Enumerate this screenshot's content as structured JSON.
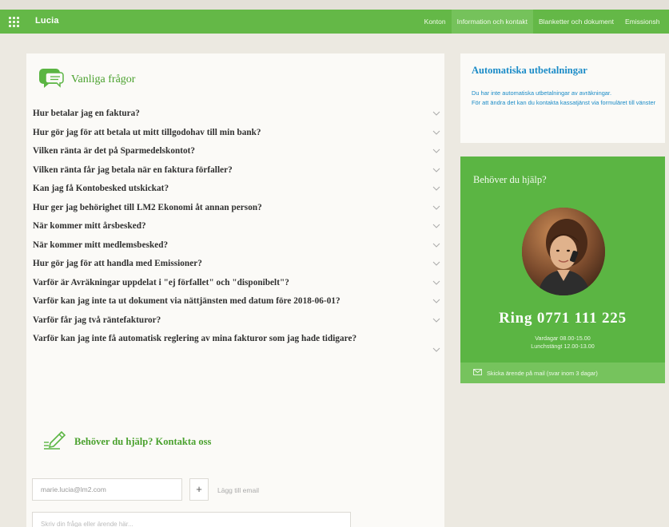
{
  "app": {
    "brand": "Lucia"
  },
  "nav": {
    "items": [
      {
        "label": "Konton",
        "active": false
      },
      {
        "label": "Information och kontakt",
        "active": true
      },
      {
        "label": "Blanketter och dokument",
        "active": false
      },
      {
        "label": "Emissionsh",
        "active": false
      }
    ]
  },
  "faq": {
    "title": "Vanliga frågor",
    "items": [
      "Hur betalar jag en faktura?",
      "Hur gör jag för att betala ut mitt tillgodohav till min bank?",
      "Vilken ränta är det på Sparmedelskontot?",
      "Vilken ränta får jag betala när en faktura förfaller?",
      "Kan jag få Kontobesked utskickat?",
      "Hur ger jag behörighet till LM2 Ekonomi åt annan person?",
      "När kommer mitt årsbesked?",
      "När kommer mitt medlemsbesked?",
      "Hur gör jag för att handla med Emissioner?",
      "Varför är Avräkningar uppdelat i \"ej förfallet\" och \"disponibelt\"?",
      "Varför kan jag inte ta ut dokument via nättjänsten med datum före 2018-06-01?",
      "Varför får jag två räntefakturor?",
      "Varför kan jag inte få automatisk reglering av mina fakturor som jag hade tidigare?"
    ]
  },
  "contact": {
    "title": "Behöver du hjälp? Kontakta oss",
    "email_value": "marie.lucia@lm2.com",
    "plus_label": "+",
    "add_email_label": "Lägg till email",
    "question_placeholder": "Skriv din fråga eller ärende här..."
  },
  "auto_payouts": {
    "title": "Automatiska utbetalningar",
    "text_line1": "Du har inte automatiska utbetalningar av avräkningar.",
    "text_line2": "För att ändra det kan du kontakta kassatjänst via formuläret till vänster"
  },
  "help": {
    "title": "Behöver du hjälp?",
    "phone": "Ring 0771 111 225",
    "hours_weekdays": "Vardagar 08.00-15.00",
    "hours_lunch": "Lunchstängt 12.00-13.00",
    "mail_text": "Skicka ärende på mail (svar inom 3 dagar)"
  },
  "colors": {
    "brand_green": "#64b847",
    "link_blue": "#1a8bc7",
    "help_green": "#5bb543"
  },
  "icons": {
    "apps": "grid-icon",
    "faq": "speech-bubble-icon",
    "contact": "pencil-icon",
    "chevron": "chevron-down-icon",
    "mail": "envelope-icon"
  }
}
